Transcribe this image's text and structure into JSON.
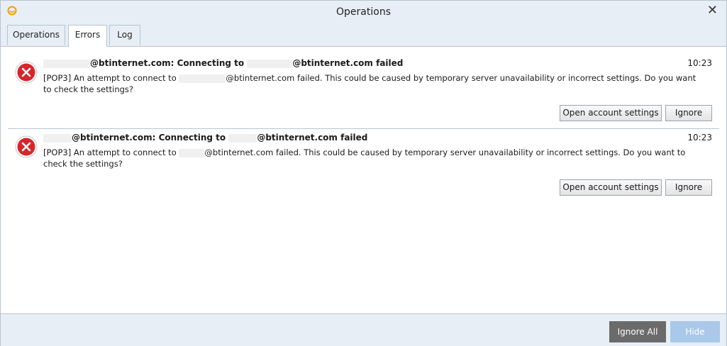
{
  "window": {
    "title": "Operations"
  },
  "tabs": [
    {
      "label": "Operations"
    },
    {
      "label": "Errors"
    },
    {
      "label": "Log"
    }
  ],
  "errors": [
    {
      "title_part1": "@btinternet.com: Connecting to",
      "title_part2": "@btinternet.com failed",
      "time": "10:23",
      "msg_part1": "[POP3] An attempt to connect to",
      "msg_part2": "@btinternet.com failed. This could be caused by temporary server unavailability or incorrect settings. Do you want to check the settings?",
      "open_label": "Open account settings",
      "ignore_label": "Ignore"
    },
    {
      "title_part1": "@btinternet.com: Connecting to",
      "title_part2": "@btinternet.com failed",
      "time": "10:23",
      "msg_part1": "[POP3] An attempt to connect to",
      "msg_part2": "@btinternet.com failed. This could be caused by temporary server unavailability or incorrect settings. Do you want to check the settings?",
      "open_label": "Open account settings",
      "ignore_label": "Ignore"
    }
  ],
  "footer": {
    "ignore_all_label": "Ignore All",
    "hide_label": "Hide"
  },
  "colors": {
    "error_red": "#d7262b",
    "accent": "#a9c8ea",
    "dark_button": "#6b6b6b",
    "app_icon": "#f2a100"
  }
}
